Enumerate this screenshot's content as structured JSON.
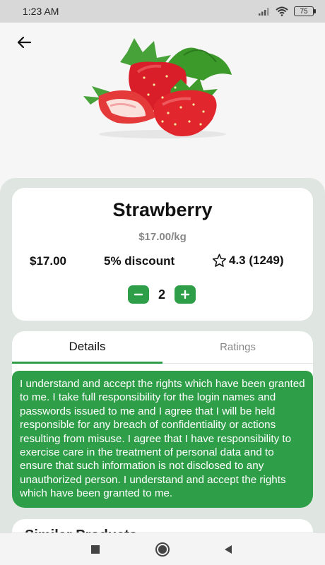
{
  "status_bar": {
    "time": "1:23 AM",
    "battery": "75"
  },
  "product": {
    "name": "Strawberry",
    "price_per_unit": "$17.00/kg",
    "price": "$17.00",
    "discount": "5% discount",
    "rating": "4.3 (1249)",
    "quantity": "2"
  },
  "tabs": [
    {
      "label": "Details",
      "active": true
    },
    {
      "label": "Ratings",
      "active": false
    }
  ],
  "details_text": "I understand and accept the rights which have been granted to me. I take full responsibility for the login names and passwords issued to me and I agree that I will be held responsible for any breach of confidentiality or actions resulting from misuse. I agree that I have responsibility to exercise care in the treatment of personal data and to ensure that such information is not disclosed to any unauthorized person. I understand and accept the rights which have been granted to me.",
  "similar_products": {
    "title": "Similar Products"
  },
  "icons": {
    "back": "arrow-left-icon",
    "star": "star-outline-icon",
    "minus": "minus-icon",
    "plus": "plus-icon",
    "nav_recent": "square-icon",
    "nav_home": "circle-icon",
    "nav_back": "triangle-back-icon"
  },
  "colors": {
    "accent": "#2f9e48",
    "sheet_bg": "#dfe5e0"
  }
}
